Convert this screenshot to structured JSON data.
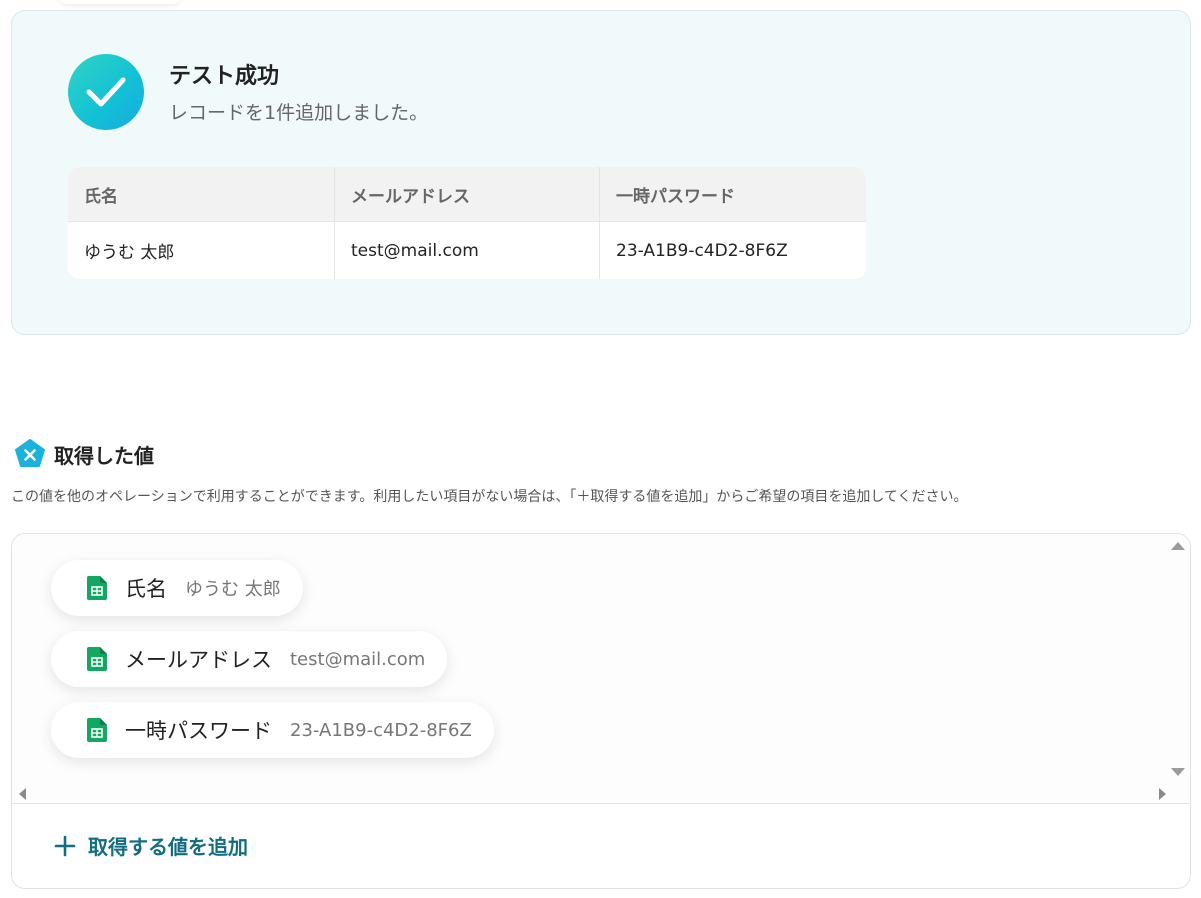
{
  "success": {
    "title": "テスト成功",
    "message": "レコードを1件追加しました。",
    "icon": "check-icon",
    "accent": "#16c6d2"
  },
  "result_table": {
    "headers": [
      "氏名",
      "メールアドレス",
      "一時パスワード"
    ],
    "rows": [
      [
        "ゆうむ 太郎",
        "test@mail.com",
        "23-A1B9-c4D2-8F6Z"
      ]
    ]
  },
  "values_section": {
    "icon": "pentagon-x-icon",
    "title": "取得した値",
    "description": "この値を他のオペレーションで利用することができます。利用したい項目がない場合は、「＋取得する値を追加」からご希望の項目を追加してください。",
    "items": [
      {
        "icon": "google-sheets-icon",
        "label": "氏名",
        "value": "ゆうむ 太郎"
      },
      {
        "icon": "google-sheets-icon",
        "label": "メールアドレス",
        "value": "test@mail.com"
      },
      {
        "icon": "google-sheets-icon",
        "label": "一時パスワード",
        "value": "23-A1B9-c4D2-8F6Z"
      }
    ],
    "add_button_label": "取得する値を追加",
    "add_button_color": "#126d82"
  }
}
